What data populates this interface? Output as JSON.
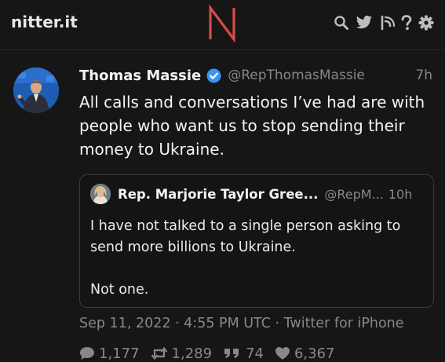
{
  "navbar": {
    "site_name": "nitter.it",
    "logo_letter": "N",
    "icons": [
      "search-icon",
      "twitter-bird-icon",
      "rss-icon",
      "help-icon",
      "gear-icon"
    ]
  },
  "tweet": {
    "fullname": "Thomas Massie",
    "username": "@RepThomasMassie",
    "date": "7h",
    "text": "All calls and conversations I’ve had are with people who want us to stop sending their money to Ukraine.",
    "published": "Sep 11, 2022 · 4:55 PM UTC · Twitter for iPhone",
    "stats": {
      "replies": "1,177",
      "retweets": "1,289",
      "quotes": "74",
      "likes": "6,367"
    }
  },
  "quote": {
    "fullname": "Rep. Marjorie Taylor Gree...",
    "username": "@RepM...",
    "date": "10h",
    "text_line1": "I have not talked to a single person asking to send more billions to Ukraine.",
    "text_line2": "Not one."
  },
  "colors": {
    "background": "#0f0f0f",
    "panel": "#161616",
    "logo_accent": "#d94a4a",
    "verified": "#3b94f2",
    "muted": "#888888"
  }
}
